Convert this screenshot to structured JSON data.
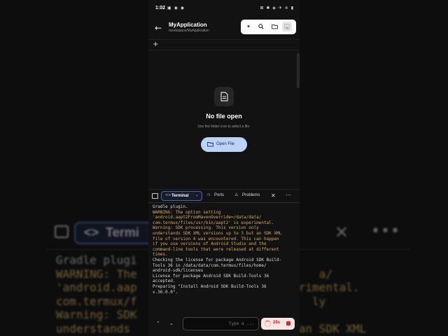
{
  "status_bar": {
    "time": "1:02",
    "left_icons": "▣ ◉ ◉",
    "right_icons": "⊠ ✱ ◈ ✈ ≋ ▮"
  },
  "header": {
    "title": "MyApplication",
    "path": "/workspace/MyApplication",
    "toolbar": {
      "ai_icon": "sparkles-icon",
      "search_icon": "search-icon",
      "folder_icon": "folder-icon",
      "save_icon": "save-icon"
    }
  },
  "editor": {
    "add_tab": "+",
    "empty_title": "No file open",
    "empty_subtitle": "Use the folder icon to select a file.",
    "open_button": "Open File"
  },
  "terminal": {
    "active_tab": "Terminal",
    "tabs": [
      "Ports",
      "Problems"
    ],
    "lines": [
      {
        "text": "Gradle plugin.",
        "warn": false
      },
      {
        "text": "WARNING: The option setting",
        "warn": true
      },
      {
        "text": "'android.aapt2FromMavenOverride=/data/data/",
        "warn": true
      },
      {
        "text": "com.termux/files/usr/bin/aapt2' is experimental.",
        "warn": true
      },
      {
        "text": "Warning: SDK processing. This version only",
        "warn": true
      },
      {
        "text": "understands SDK XML versions up to 3 but an SDK XML",
        "warn": true
      },
      {
        "text": "file of version 4 was encountered. This can happen",
        "warn": true
      },
      {
        "text": "if you use versions of Android Studio and the",
        "warn": true
      },
      {
        "text": "command-line tools that were released at different",
        "warn": true
      },
      {
        "text": "times.",
        "warn": true
      },
      {
        "text": "Checking the license for package Android SDK Build-",
        "warn": false
      },
      {
        "text": "Tools 36 in /data/data/com.termux/files/home/",
        "warn": false
      },
      {
        "text": "android-sdk/licenses",
        "warn": false
      },
      {
        "text": "License for package Android SDK Build-Tools 36",
        "warn": false
      },
      {
        "text": "accepted.",
        "warn": false
      },
      {
        "text": "Preparing \"Install Android SDK Build-Tools 36",
        "warn": false
      },
      {
        "text": "v.36.0.0\".",
        "warn": false
      }
    ],
    "input_placeholder": "Type a ...",
    "timer": "29s"
  },
  "background": {
    "tab_label": "Termi",
    "lines": [
      {
        "text": "Gradle plugi",
        "warn": false
      },
      {
        "text": "WARNING: The                           a/",
        "warn": true
      },
      {
        "text": "'android.aap                     xperimental.",
        "warn": true
      },
      {
        "text": "com.termux/f                          ly",
        "warn": true
      },
      {
        "text": "Warning: SDK",
        "warn": true
      },
      {
        "text": "understands                         an SDK XML",
        "warn": true
      }
    ]
  },
  "colors": {
    "accent": "#4a67a8",
    "warning_text": "#d7a85e",
    "open_button_bg": "#bcd3f7",
    "timer_bg": "#ffe4e4",
    "stop": "#d62a2a"
  }
}
